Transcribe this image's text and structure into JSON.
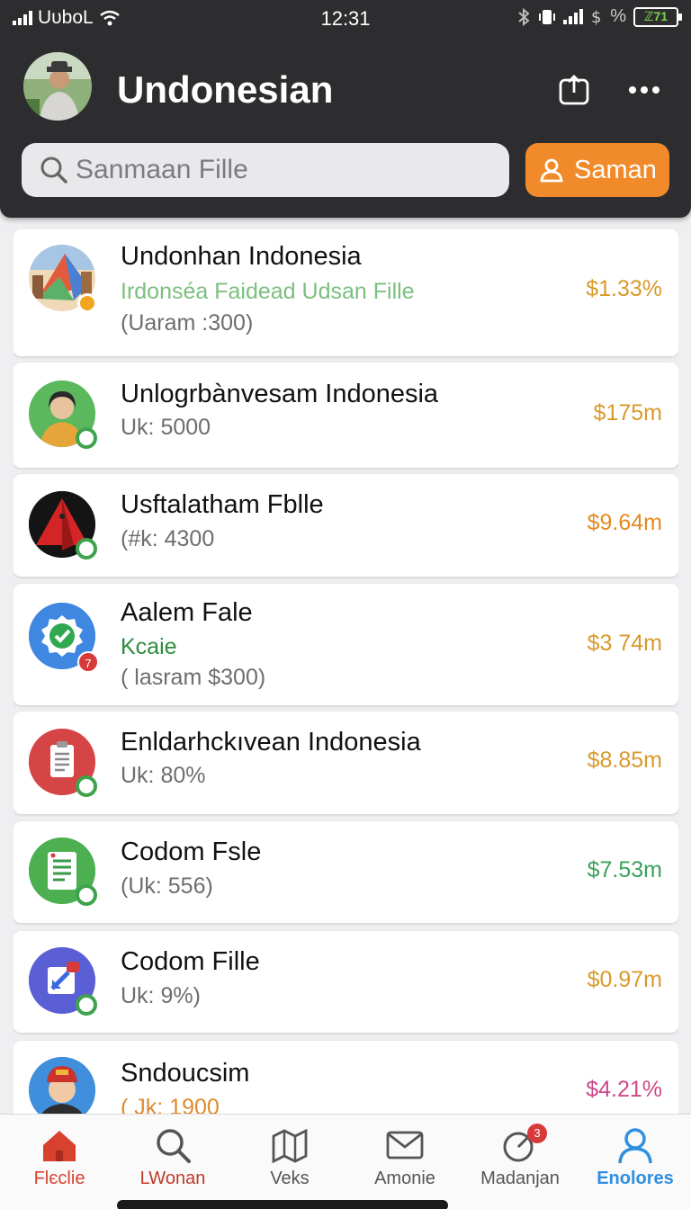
{
  "status": {
    "carrier": "UᴜbᴏL",
    "time": "12:31",
    "percent_glyph": "%",
    "battery_text": "ℤ71"
  },
  "header": {
    "title": "Undonesian"
  },
  "search": {
    "placeholder": "Sanmaan Fille"
  },
  "action_button": {
    "label": "Saman"
  },
  "items": [
    {
      "name": "Undonhan Indonesia",
      "sub": "Irdonséa Faidead Udsan Fille",
      "sub_color": "#7bbf7f",
      "sub2": "(Uaram :300)",
      "price": "$1.33%",
      "price_color": "#d99a2b",
      "icon": "map-icon"
    },
    {
      "name": "Unlogrbànvesam Indonesia",
      "sub": "Uk: 5000",
      "price": "$175m",
      "price_color": "#d99a2b",
      "icon": "person-avatar-icon"
    },
    {
      "name": "Usftalatham Fblle",
      "sub": "(#k: 4300",
      "price": "$9.64m",
      "price_color": "#e58a1f",
      "icon": "red-pyramid-icon"
    },
    {
      "name": "Aalem Fale",
      "sub": "Kcaie",
      "sub_color": "#2e8b3e",
      "sub2": "( lasram $300)",
      "price": "$3 74m",
      "price_color": "#d99a2b",
      "icon": "verified-badge-icon",
      "badge": "7"
    },
    {
      "name": "Enldarhckıvean Indonesia",
      "sub": "Uk: 80%",
      "price": "$8.85m",
      "price_color": "#d99a2b",
      "icon": "clipboard-icon"
    },
    {
      "name": "Codom Fsle",
      "sub": "(Uk: 556)",
      "price": "$7.53m",
      "price_color": "#3aa25a",
      "icon": "document-icon"
    },
    {
      "name": "Codom Fille",
      "sub": "Uk: 9%)",
      "price": "$0.97m",
      "price_color": "#d99a2b",
      "icon": "share-icon"
    },
    {
      "name": "Sndoucsim",
      "sub": "( Jk: 1900",
      "price": "$4.21%",
      "price_color": "#cc4a8a",
      "icon": "cartoon-avatar-icon"
    }
  ],
  "tabs": [
    {
      "label": "Flєclie",
      "icon": "home-icon",
      "color": "#d7412e"
    },
    {
      "label": "LWonan",
      "icon": "search-icon",
      "color": "#c0392b"
    },
    {
      "label": "Veks",
      "icon": "map-icon",
      "color": "#555555"
    },
    {
      "label": "Amonie",
      "icon": "mail-icon",
      "color": "#555555"
    },
    {
      "label": "Madanjan",
      "icon": "activity-icon",
      "color": "#555555",
      "badge": "3"
    },
    {
      "label": "Enolores",
      "icon": "profile-icon",
      "color": "#2f8fe0"
    }
  ]
}
